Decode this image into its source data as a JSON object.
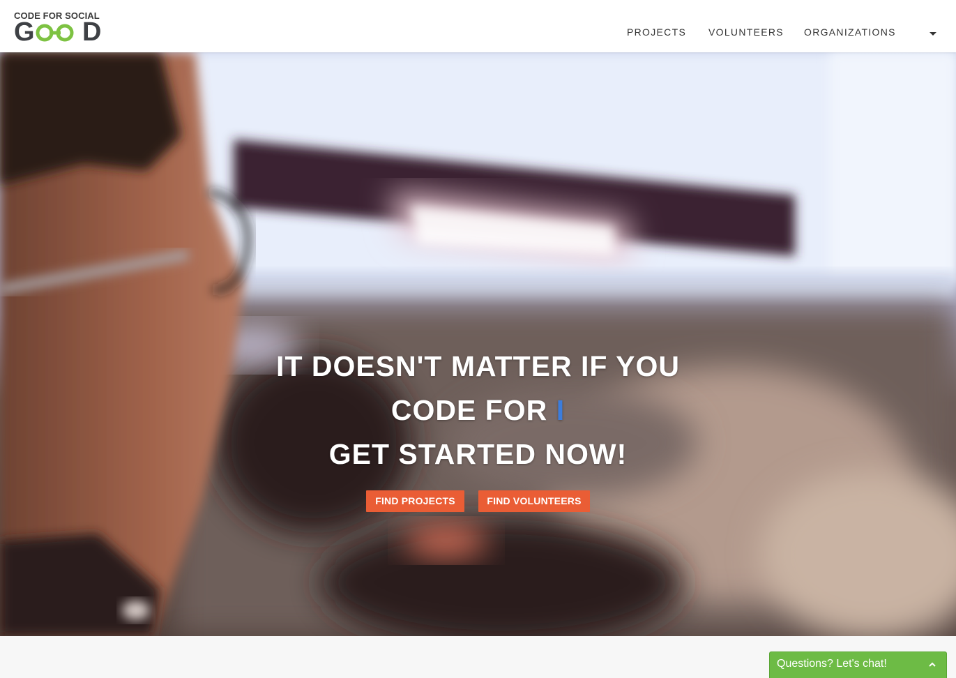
{
  "header": {
    "logo": {
      "top_text": "CODE FOR SOCIAL",
      "word": "GOOD",
      "letters": [
        "G",
        "D"
      ],
      "colors": {
        "dark": "#3e4145",
        "green": "#7dc242"
      }
    },
    "nav": [
      "PROJECTS",
      "VOLUNTEERS",
      "ORGANIZATIONS"
    ],
    "menu_icon": "caret-down-icon"
  },
  "hero": {
    "line1": "IT DOESN'T MATTER IF YOU",
    "line2_prefix": "CODE FOR",
    "line2_cursor": "I",
    "line3": "GET STARTED NOW!",
    "buttons": [
      "FIND PROJECTS",
      "FIND VOLUNTEERS"
    ],
    "colors": {
      "button": "#ea5d35",
      "cursor": "#3b7ddd",
      "text": "#ffffff"
    }
  },
  "chat": {
    "label": "Questions? Let's chat!",
    "icon": "chevron-up-icon",
    "color": "#6dbb45"
  }
}
